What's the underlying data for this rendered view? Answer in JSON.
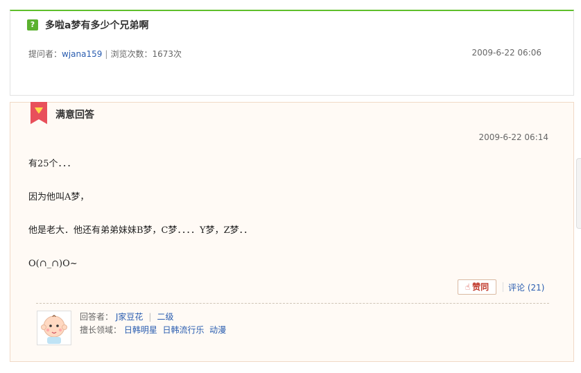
{
  "question": {
    "title": "多啦a梦有多少个兄弟啊",
    "asker_label": "提问者：",
    "asker": "wjana159",
    "separator": "|",
    "views_label": "浏览次数：",
    "views": "1673次",
    "date": "2009-6-22 06:06"
  },
  "answer": {
    "label": "满意回答",
    "date": "2009-6-22 06:14",
    "lines": [
      "有25个．．．",
      "因为他叫A梦，",
      "他是老大．他还有弟弟妹妹B梦，C梦．．．．Y梦，Z梦．．",
      "O(∩_∩)O~"
    ],
    "like_label": "赞同",
    "comment_label": "评论",
    "comment_count": "(21)",
    "answerer_label": "回答者：",
    "answerer": "J家豆花",
    "level": "二级",
    "expertise_label": "擅长领域：",
    "expertise": [
      "日韩明星",
      "日韩流行乐",
      "动漫"
    ]
  },
  "colors": {
    "accent_green": "#5fbf2b",
    "link_blue": "#2a5db0",
    "ribbon_red": "#e8505b"
  }
}
